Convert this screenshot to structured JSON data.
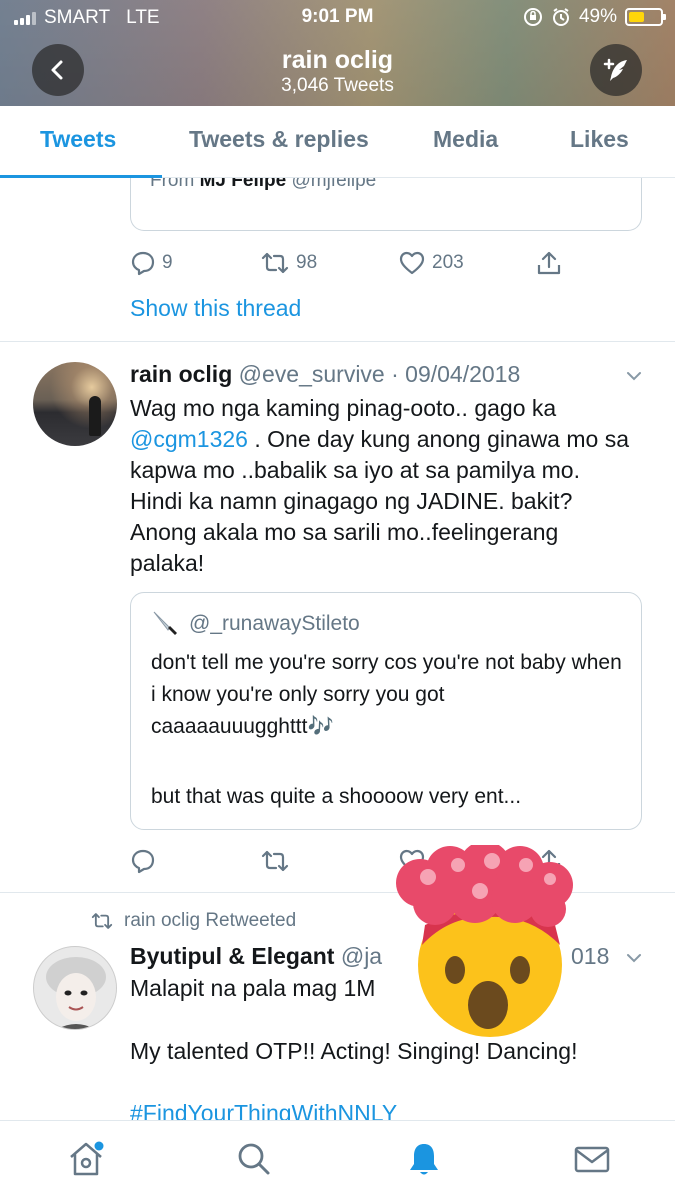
{
  "status": {
    "carrier": "SMART",
    "network": "LTE",
    "time": "9:01 PM",
    "battery_percent": "49%",
    "battery_level": 0.49
  },
  "header": {
    "title": "rain oclig",
    "subtitle": "3,046 Tweets"
  },
  "tabs": [
    "Tweets",
    "Tweets & replies",
    "Media",
    "Likes"
  ],
  "active_tab": "Tweets",
  "tweet1": {
    "quote_from_prefix": "From",
    "quote_from_name": "MJ Felipe",
    "quote_from_handle": "@mjfelipe",
    "replies": "9",
    "retweets": "98",
    "likes": "203",
    "show_thread": "Show this thread"
  },
  "tweet2": {
    "name": "rain oclig",
    "handle_date": "@eve_survive · 09/04/2018",
    "text_before": "Wag mo nga kaming pinag-ooto.. gago ka ",
    "mention": "@cgm1326",
    "text_after": " . One day kung anong ginawa mo sa kapwa mo ..babalik sa iyo at sa pamilya mo. Hindi ka namn ginagago ng JADINE. bakit? Anong akala mo sa sarili mo..feelingerang palaka!",
    "quote_handle": "@_runawayStileto",
    "quote_text": "don't tell me you're sorry cos you're not baby when i know you're only sorry you got caaaaauuugghttt🎶",
    "quote_text2": "but that was quite a shoooow very ent..."
  },
  "tweet3": {
    "retweeted_label": "rain oclig Retweeted",
    "name": "Byutipul & Elegant",
    "handle_fragment": "@ja",
    "date_fragment": "018",
    "line1": "Malapit na pala mag 1M",
    "line2": "My talented OTP!! Acting! Singing! Dancing!",
    "hashtag": "#FindYourThingWithNNLY"
  },
  "colors": {
    "accent": "#1b95e0",
    "muted": "#657786",
    "text": "#14171a",
    "border": "#e1e8ed"
  }
}
